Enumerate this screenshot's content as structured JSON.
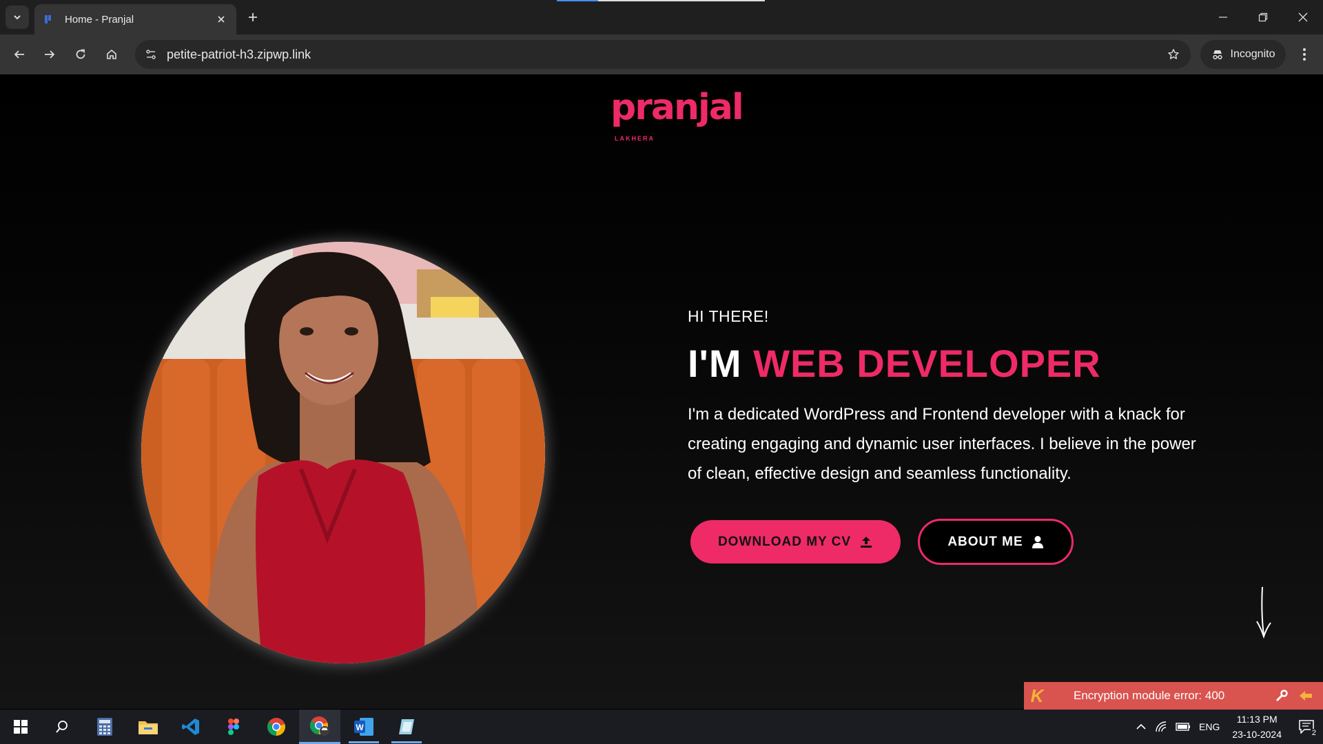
{
  "browser": {
    "tab_title": "Home - Pranjal",
    "url": "petite-patriot-h3.zipwp.link",
    "incognito_label": "Incognito"
  },
  "page": {
    "logo_text": "pranjal",
    "logo_subtext": "LAKHERA",
    "greeting": "HI THERE!",
    "headline_prefix": "I'M",
    "headline_accent": "WEB DEVELOPER",
    "description": "I'm a dedicated WordPress and Frontend developer with a knack for creating engaging and dynamic user interfaces. I believe in the power of clean, effective design and seamless functionality.",
    "download_cv_label": "DOWNLOAD MY CV",
    "about_me_label": "ABOUT ME",
    "accent_color": "#ee2a67"
  },
  "notification": {
    "message": "Encryption module error: 400"
  },
  "taskbar": {
    "apps": [
      "start-icon",
      "search-icon",
      "calculator-icon",
      "file-explorer-icon",
      "vscode-icon",
      "figma-icon",
      "chrome-icon",
      "chrome-incognito-icon",
      "word-icon",
      "notes-icon"
    ],
    "language": "ENG",
    "time": "11:13 PM",
    "date": "23-10-2024",
    "notification_count": "2"
  }
}
